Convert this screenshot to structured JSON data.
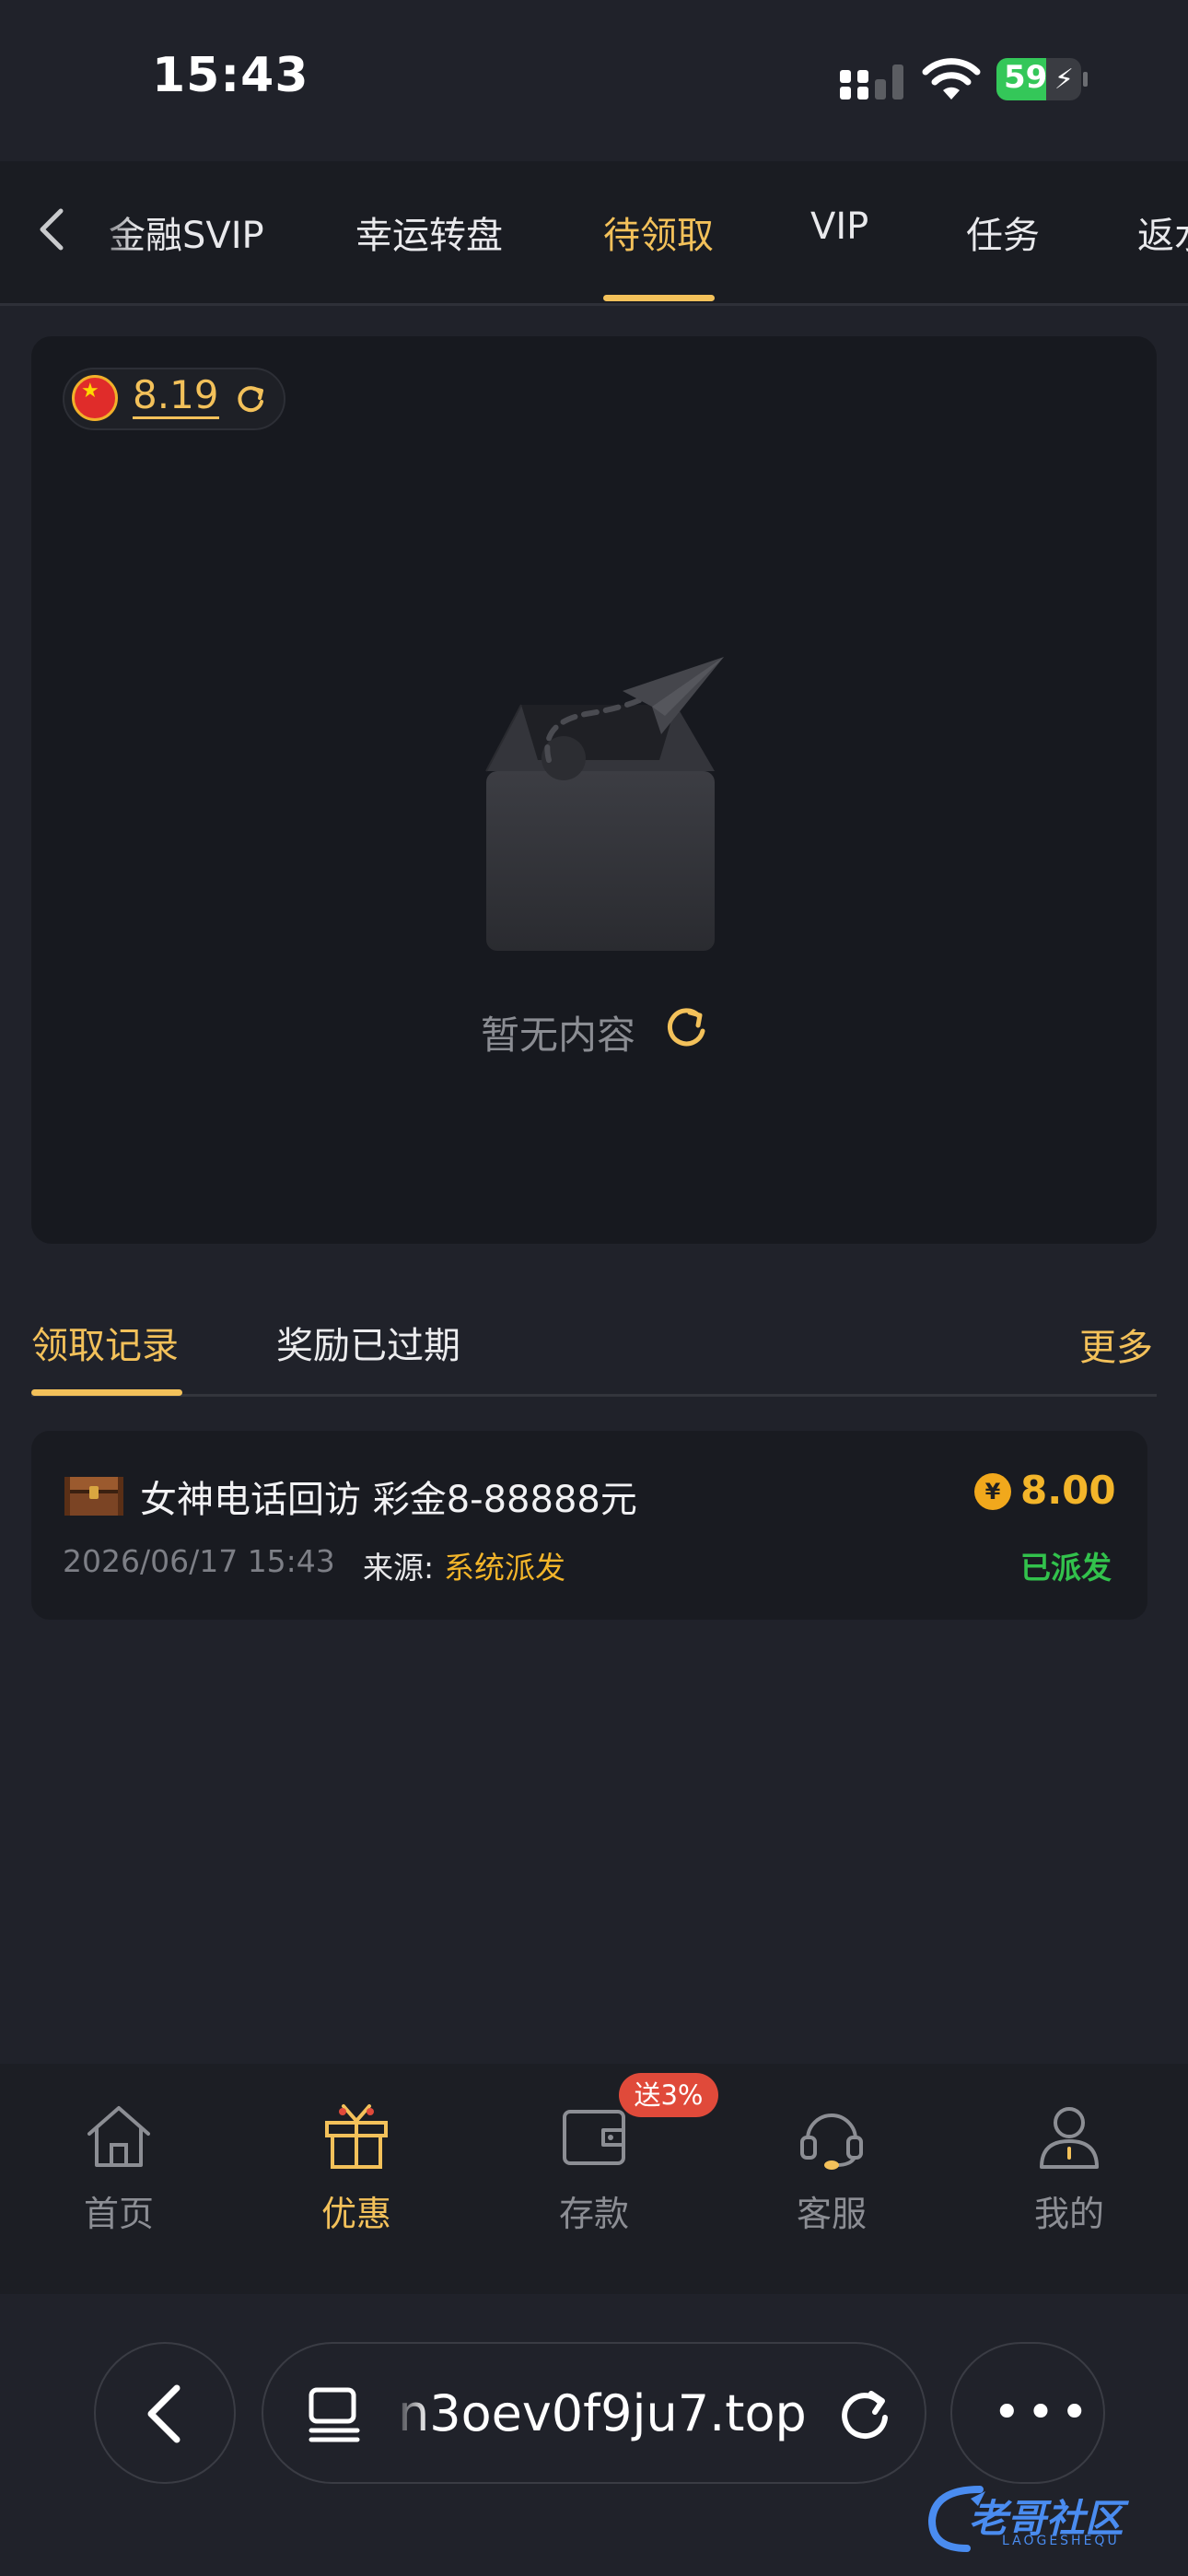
{
  "status_bar": {
    "time": "15:43",
    "battery": "59"
  },
  "tabs": [
    {
      "label": "金融SVIP"
    },
    {
      "label": "幸运转盘"
    },
    {
      "label": "待领取"
    },
    {
      "label": "VIP"
    },
    {
      "label": "任务"
    },
    {
      "label": "返水"
    }
  ],
  "active_tab": "待领取",
  "balance": {
    "value": "8.19"
  },
  "empty_state": {
    "text": "暂无内容"
  },
  "sub_tabs": {
    "records": "领取记录",
    "expired": "奖励已过期",
    "more": "更多"
  },
  "record": {
    "title": "女神电话回访 彩金8-88888元",
    "amount": "8.00",
    "coin_symbol": "¥",
    "time": "2026/06/17 15:43",
    "source_label": "来源:",
    "source_value": "系统派发",
    "status": "已派发"
  },
  "bottom_nav": [
    {
      "label": "首页",
      "icon": "home-icon"
    },
    {
      "label": "优惠",
      "icon": "gift-icon"
    },
    {
      "label": "存款",
      "icon": "wallet-icon"
    },
    {
      "label": "客服",
      "icon": "headset-icon"
    },
    {
      "label": "我的",
      "icon": "user-icon"
    }
  ],
  "deposit_badge": "送3%",
  "browser": {
    "url": "n3oev0f9ju7.top"
  },
  "watermark": {
    "text": "老哥社区",
    "sub": "LAOGESHEQU"
  },
  "colors": {
    "accent": "#f3c15a",
    "success": "#32c24c",
    "badge": "#e04a3a",
    "background": "#20222a"
  }
}
